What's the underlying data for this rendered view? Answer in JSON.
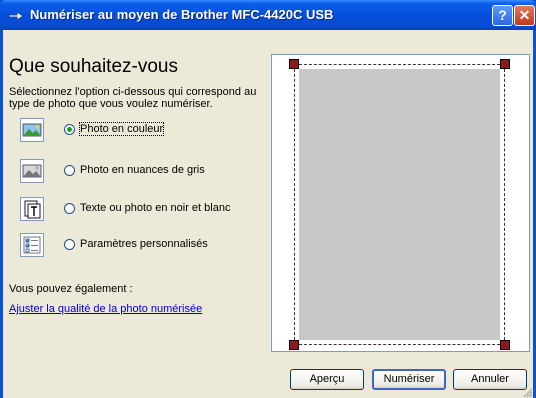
{
  "window": {
    "title": "Numériser au moyen de Brother MFC-4420C USB",
    "help_label": "?",
    "close_label": "✕"
  },
  "main": {
    "heading": "Que souhaitez-vous",
    "description": "Sélectionnez l'option ci-dessous qui correspond au type de photo que vous voulez numériser.",
    "options": [
      {
        "label": "Photo en couleur",
        "icon": "color-photo-icon",
        "selected": true
      },
      {
        "label": "Photo en nuances de gris",
        "icon": "grayscale-photo-icon",
        "selected": false
      },
      {
        "label": "Texte ou photo en noir et blanc",
        "icon": "text-bw-icon",
        "selected": false
      },
      {
        "label": "Paramètres personnalisés",
        "icon": "custom-settings-icon",
        "selected": false
      }
    ],
    "also_label": "Vous pouvez également :",
    "adjust_link": "Ajuster la qualité de la photo numérisée"
  },
  "buttons": {
    "preview": "Aperçu",
    "scan": "Numériser",
    "cancel": "Annuler"
  },
  "colors": {
    "titlebar": "#0550DC",
    "link": "#0000CC",
    "handle": "#8B1A1A",
    "scan_area": "#C8C8C8"
  }
}
